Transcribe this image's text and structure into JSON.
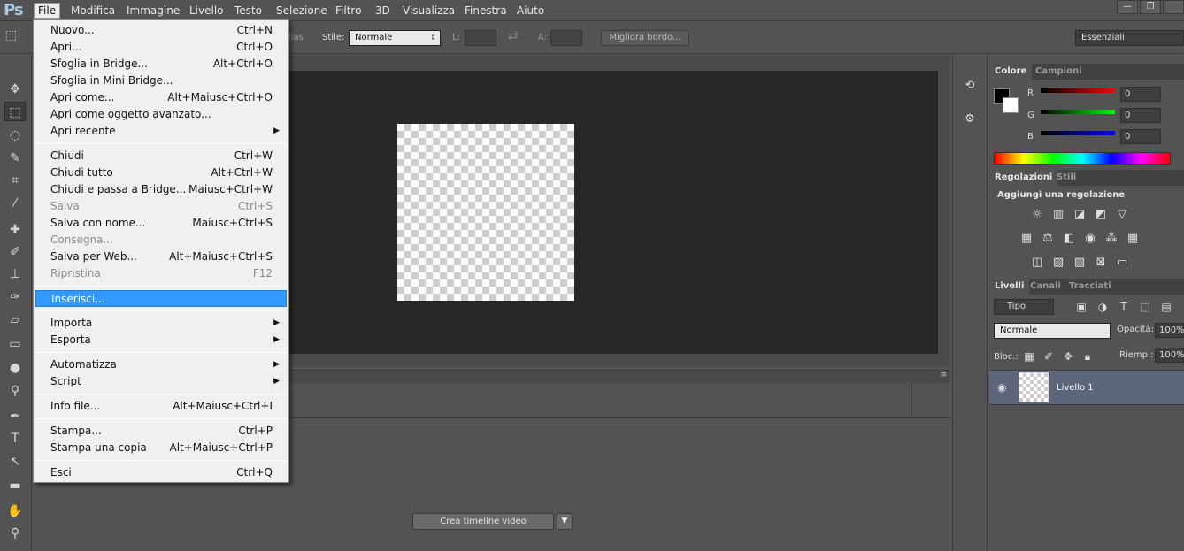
{
  "app": {
    "logo": "Ps"
  },
  "menubar": {
    "items": [
      "File",
      "Modifica",
      "Immagine",
      "Livello",
      "Testo",
      "Selezione",
      "Filtro",
      "3D",
      "Visualizza",
      "Finestra",
      "Aiuto"
    ],
    "active": "File"
  },
  "window_controls": {
    "minimize": "—",
    "restore": "❐"
  },
  "options": {
    "antialias_partial": "lias",
    "style_label": "Stile:",
    "style_value": "Normale",
    "width_label": "L:",
    "height_label": "A:",
    "refine_button": "Migliora bordo...",
    "workspace": "Essenziali"
  },
  "file_menu": {
    "groups": [
      [
        {
          "label": "Nuovo...",
          "shortcut": "Ctrl+N"
        },
        {
          "label": "Apri...",
          "shortcut": "Ctrl+O"
        },
        {
          "label": "Sfoglia in Bridge...",
          "shortcut": "Alt+Ctrl+O"
        },
        {
          "label": "Sfoglia in Mini Bridge...",
          "shortcut": ""
        },
        {
          "label": "Apri come...",
          "shortcut": "Alt+Maiusc+Ctrl+O"
        },
        {
          "label": "Apri come oggetto avanzato...",
          "shortcut": ""
        },
        {
          "label": "Apri recente",
          "shortcut": "",
          "submenu": true
        }
      ],
      [
        {
          "label": "Chiudi",
          "shortcut": "Ctrl+W"
        },
        {
          "label": "Chiudi tutto",
          "shortcut": "Alt+Ctrl+W"
        },
        {
          "label": "Chiudi e passa a Bridge...",
          "shortcut": "Maiusc+Ctrl+W"
        },
        {
          "label": "Salva",
          "shortcut": "Ctrl+S",
          "disabled": true
        },
        {
          "label": "Salva con nome...",
          "shortcut": "Maiusc+Ctrl+S"
        },
        {
          "label": "Consegna...",
          "shortcut": "",
          "disabled": true
        },
        {
          "label": "Salva per Web...",
          "shortcut": "Alt+Maiusc+Ctrl+S"
        },
        {
          "label": "Ripristina",
          "shortcut": "F12",
          "disabled": true
        }
      ],
      [
        {
          "label": "Inserisci...",
          "shortcut": "",
          "highlighted": true
        }
      ],
      [
        {
          "label": "Importa",
          "shortcut": "",
          "submenu": true
        },
        {
          "label": "Esporta",
          "shortcut": "",
          "submenu": true
        }
      ],
      [
        {
          "label": "Automatizza",
          "shortcut": "",
          "submenu": true
        },
        {
          "label": "Script",
          "shortcut": "",
          "submenu": true
        }
      ],
      [
        {
          "label": "Info file...",
          "shortcut": "Alt+Maiusc+Ctrl+I"
        }
      ],
      [
        {
          "label": "Stampa...",
          "shortcut": "Ctrl+P"
        },
        {
          "label": "Stampa una copia",
          "shortcut": "Alt+Maiusc+Ctrl+P"
        }
      ],
      [
        {
          "label": "Esci",
          "shortcut": "Ctrl+Q"
        }
      ]
    ]
  },
  "timeline": {
    "create_button": "Crea timeline video"
  },
  "color_panel": {
    "tabs": [
      "Colore",
      "Campioni"
    ],
    "active_tab": "Colore",
    "channels": [
      {
        "name": "R",
        "value": "0",
        "color": "#ff0000"
      },
      {
        "name": "G",
        "value": "0",
        "color": "#00ff00"
      },
      {
        "name": "B",
        "value": "0",
        "color": "#0000ff"
      }
    ],
    "foreground": "#000000",
    "background": "#ffffff"
  },
  "adjustments_panel": {
    "tabs": [
      "Regolazioni",
      "Stili"
    ],
    "active_tab": "Regolazioni",
    "heading": "Aggiungi una regolazione"
  },
  "layers_panel": {
    "tabs": [
      "Livelli",
      "Canali",
      "Tracciati"
    ],
    "active_tab": "Livelli",
    "filter_kind": "Tipo",
    "blend_mode": "Normale",
    "opacity_label": "Opacità:",
    "opacity_value": "100%",
    "lock_label": "Bloc.:",
    "fill_label": "Riemp.:",
    "fill_value": "100%",
    "layers": [
      {
        "name": "Livello 1",
        "visible": true
      }
    ]
  }
}
